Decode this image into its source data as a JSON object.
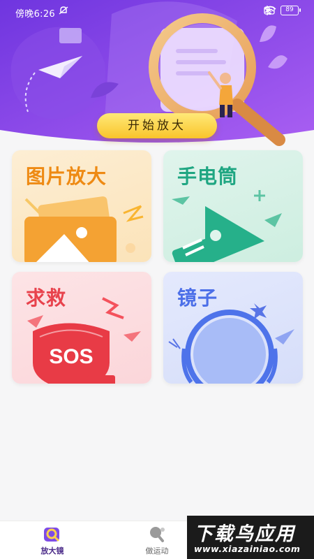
{
  "status_bar": {
    "time": "傍晚6:26",
    "left_icon": "no-notification-icon",
    "battery_level": "89",
    "icons": [
      "bluetooth-icon",
      "sim-off-icon",
      "wifi-icon",
      "battery-icon"
    ]
  },
  "header": {
    "start_button_label": "开始放大",
    "illustration": "magnifier-scene-illustration"
  },
  "features": [
    {
      "label": "图片放大",
      "icon": "image-icon",
      "color": "#ee8a13"
    },
    {
      "label": "手电筒",
      "icon": "flashlight-icon",
      "color": "#1fa682"
    },
    {
      "label": "求救",
      "icon": "sos-shield-icon",
      "color": "#e8434d"
    },
    {
      "label": "镜子",
      "icon": "mirror-icon",
      "color": "#4c6fe8"
    }
  ],
  "bottom_nav": {
    "items": [
      {
        "label": "放大镜",
        "icon": "magnifier-nav-icon",
        "active": true
      },
      {
        "label": "做运动",
        "icon": "ping-pong-icon",
        "active": false
      }
    ]
  },
  "watermark": {
    "main": "下载鸟应用",
    "sub": "www.xiazainiao.com"
  },
  "colors": {
    "header_gradient_start": "#7b3fe4",
    "header_gradient_end": "#a45cf0",
    "button_yellow": "#f9c42b"
  }
}
